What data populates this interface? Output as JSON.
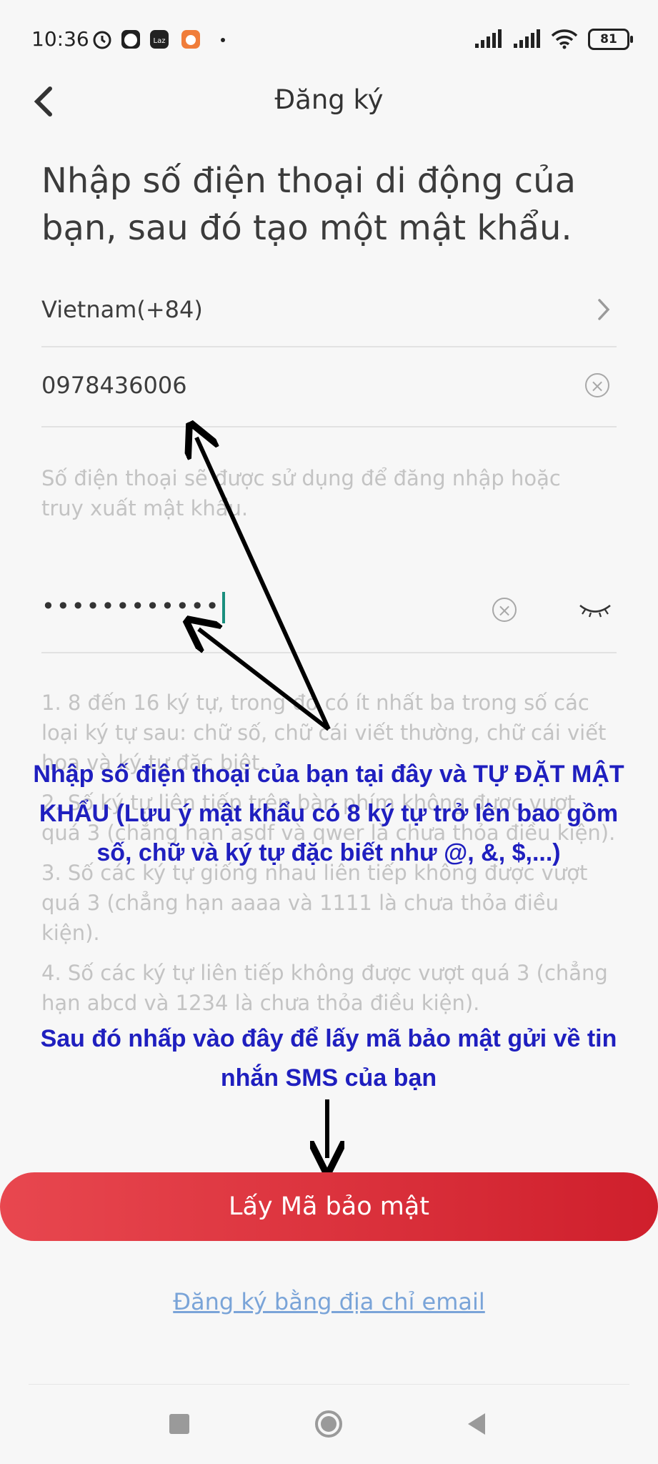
{
  "status_bar": {
    "time": "10:36",
    "notification_icons": [
      "alarm-icon",
      "face-app-icon",
      "lazada-icon",
      "shopee-icon",
      "dot-icon"
    ],
    "battery": "81",
    "signal_icons": [
      "signal-icon",
      "signal-icon",
      "wifi-icon",
      "battery-icon"
    ]
  },
  "header": {
    "title": "Đăng ký"
  },
  "headline": "Nhập số điện thoại di động của bạn, sau đó tạo một mật khẩu.",
  "form": {
    "country": "Vietnam(+84)",
    "phone": "0978436006",
    "phone_hint": "Số điện thoại sẽ được sử dụng để đăng nhập hoặc truy xuất mật khẩu.",
    "password_mask": "••••••••••••"
  },
  "rules": [
    "1. 8 đến 16 ký tự, trong đó có ít nhất ba trong số các loại ký tự sau: chữ số, chữ cái viết thường, chữ cái viết hoa và ký tự đặc biệt.",
    "2. Số ký tự liên tiếp trên bàn phím không được vượt quá 3 (chẳng hạn asdf và qwer là chưa thỏa điều kiện).",
    "3. Số các ký tự giống nhau liên tiếp không được vượt quá 3 (chẳng hạn aaaa và 1111 là chưa thỏa điều kiện).",
    "4. Số các ký tự liên tiếp không được vượt quá 3 (chẳng hạn abcd và 1234 là chưa thỏa điều kiện)."
  ],
  "annotations": {
    "first": "Nhập số điện thoại của bạn tại đây và TỰ ĐẶT MẬT KHẨU (Lưu ý mật khẩu có 8 ký tự trở lên bao gồm số, chữ và ký tự đặc biết như @, &, $,...)",
    "second": "Sau đó nhấp vào đây để lấy mã bảo mật gửi về tin nhắn SMS của bạn"
  },
  "actions": {
    "get_code": "Lấy Mã bảo mật",
    "email_register": "Đăng ký bằng địa chỉ email"
  },
  "colors": {
    "accent": "#d92833",
    "annotation": "#1f1fbf",
    "link": "#7aa4d8"
  }
}
